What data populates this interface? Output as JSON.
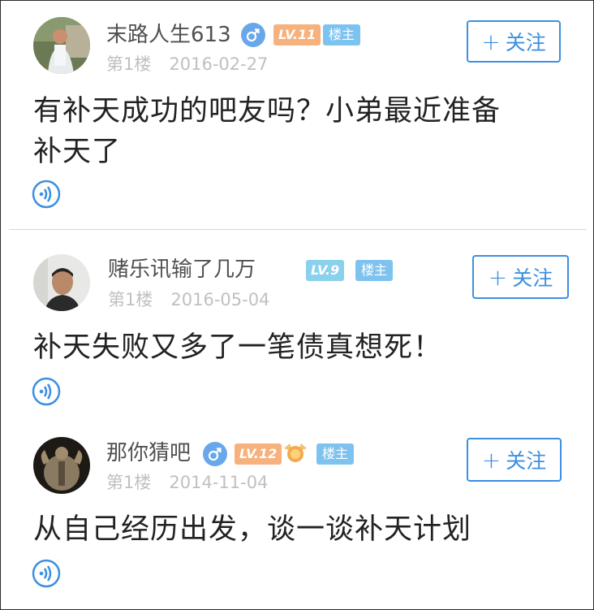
{
  "posts": [
    {
      "username": "末路人生613",
      "level": "LV.11",
      "level_color": "#f7b17d",
      "badge": "楼主",
      "floor": "第1楼",
      "date": "2016-02-27",
      "follow_label": "关注",
      "follow_plus": "+",
      "content_line1": "有补天成功的吧友吗？小弟最近准备",
      "content_line2": "补天了",
      "has_gender": true
    },
    {
      "username": "赌乐讯输了几万",
      "level": "LV.9",
      "level_color": "#8ad1ec",
      "badge": "楼主",
      "floor": "第1楼",
      "date": "2016-05-04",
      "follow_label": "关注",
      "follow_plus": "+",
      "content_line1": "补天失败又多了一笔债真想死！",
      "has_gender": false
    },
    {
      "username": "那你猜吧",
      "level": "LV.12",
      "level_color": "#f7b17d",
      "badge": "楼主",
      "floor": "第1楼",
      "date": "2014-11-04",
      "follow_label": "关注",
      "follow_plus": "+",
      "content_line1": "从自己经历出发，谈一谈补天计划",
      "has_gender": true
    }
  ],
  "colors": {
    "accent": "#3d8fe0",
    "gender": "#68a8ea",
    "badge": "#7ec3ef",
    "meta": "#c0c0c0"
  },
  "icons": {
    "gender": "male-icon",
    "voice": "voice-play-icon",
    "medal": "medal-icon"
  }
}
